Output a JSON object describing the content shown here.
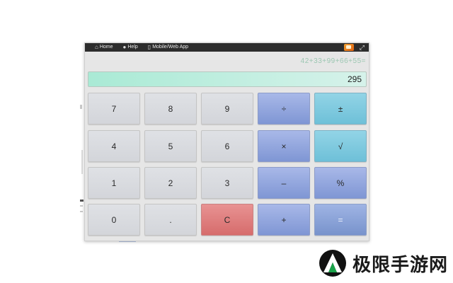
{
  "nav": {
    "home_label": "Home",
    "help_label": "Help",
    "mobile_label": "Mobile/Web App"
  },
  "icons": {
    "home": "home-icon",
    "help": "help-icon",
    "mobile": "mobile-icon",
    "settings": "settings-icon",
    "expand": "expand-icon"
  },
  "history_text": "42+33+99+66+55=",
  "display_value": "295",
  "keys": {
    "seven": "7",
    "eight": "8",
    "nine": "9",
    "divide": "÷",
    "plus_minus": "±",
    "four": "4",
    "five": "5",
    "six": "6",
    "multiply": "×",
    "sqrt": "√",
    "one": "1",
    "two": "2",
    "three": "3",
    "minus": "–",
    "percent": "%",
    "zero": "0",
    "decimal": ".",
    "clear": "C",
    "plus": "+",
    "equals": "="
  },
  "colors": {
    "display_bg": "#a9ead5",
    "operator_key": "#8ea2dc",
    "function_key": "#7fcadf",
    "clear_key": "#de7c7c",
    "topbar_bg": "#2c2c2c"
  },
  "watermark": {
    "text": "极限手游网"
  }
}
